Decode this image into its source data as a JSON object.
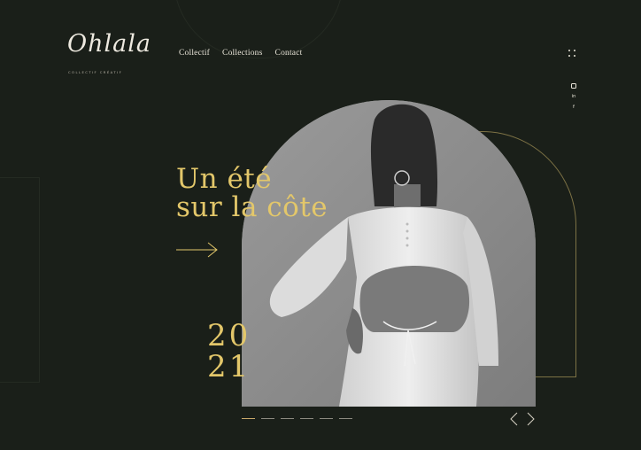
{
  "logo": {
    "script": "Ohlala",
    "subtitle": "COLLECTIF CRÉATIF"
  },
  "nav": {
    "items": [
      "Collectif",
      "Collections",
      "Contact"
    ]
  },
  "menu": {
    "icon": "grid-dots-icon"
  },
  "social": {
    "items": [
      "instagram-icon",
      "in",
      "f"
    ]
  },
  "hero": {
    "line1": "Un été",
    "line2": "sur la côte",
    "year_top": "20",
    "year_bottom": "21"
  },
  "pager": {
    "count": 6,
    "active_index": 0
  },
  "colors": {
    "background": "#1a1f19",
    "accent": "#e3c76a",
    "outline": "#7d7245"
  }
}
